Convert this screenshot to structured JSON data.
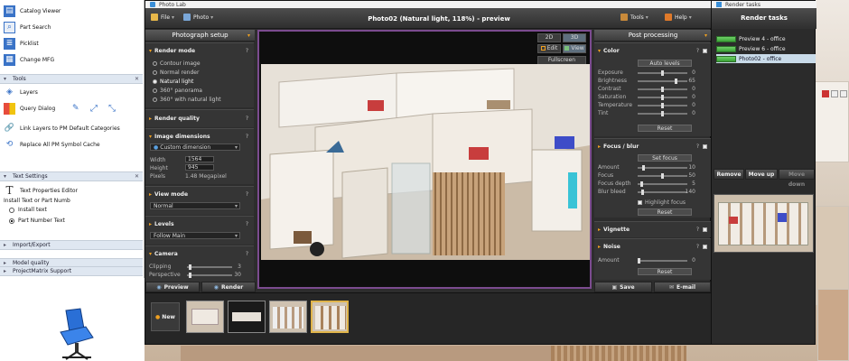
{
  "host_panel": {
    "items_top": [
      {
        "label": "Catalog Viewer",
        "icon": "catalog-icon",
        "color": "#3a73c7"
      },
      {
        "label": "Part Search",
        "icon": "part-search-icon",
        "color": "#3a73c7"
      },
      {
        "label": "Picklist",
        "icon": "picklist-icon",
        "color": "#3a73c7"
      },
      {
        "label": "Change MFG",
        "icon": "change-mfg-icon",
        "color": "#3a73c7"
      }
    ],
    "tools_header": "Tools",
    "tools_items": [
      {
        "label": "Layers",
        "icon": "layers-icon"
      },
      {
        "label": "Query Dialog",
        "icon": "query-icon"
      },
      {
        "label": "Link Layers to PM Default Categories",
        "icon": "link-icon"
      },
      {
        "label": "Replace All PM Symbol Cache",
        "icon": "replace-icon"
      }
    ],
    "text_settings_header": "Text Settings",
    "text_properties_label": "Text Properties Editor",
    "install_text_group": "Install Text or Part Numb",
    "install_text_option": "Install text",
    "part_number_option": "Part Number Text",
    "import_export_header": "Import/Export",
    "model_quality_header": "Model quality",
    "project_matrix_header": "ProjectMatrix Support"
  },
  "photo_lab": {
    "window_title": "Photo Lab",
    "menu_file": "File",
    "menu_photo": "Photo",
    "doc_title": "Photo02 (Natural light, 118%) - preview",
    "menu_tools": "Tools",
    "menu_help": "Help",
    "left_header": "Photograph setup",
    "right_header": "Post processing",
    "render_mode": {
      "title": "Render mode",
      "options": [
        "Contour image",
        "Normal render",
        "Natural light",
        "360° panorama",
        "360° with natural light"
      ],
      "selected": 2
    },
    "render_quality_title": "Render quality",
    "image_dimensions": {
      "title": "Image dimensions",
      "preset": "Custom dimension",
      "width_label": "Width",
      "width_value": "1564",
      "height_label": "Height",
      "height_value": "945",
      "pixels_label": "Pixels",
      "pixels_value": "1.48 Megapixel"
    },
    "view_mode": {
      "title": "View mode",
      "value": "Normal"
    },
    "levels": {
      "title": "Levels",
      "value": "Follow Main"
    },
    "camera": {
      "title": "Camera",
      "clipping_label": "Clipping",
      "clipping_value": "3",
      "perspective_label": "Perspective",
      "perspective_value": "30"
    },
    "view_buttons": {
      "b2d": "2D",
      "b3d": "3D",
      "edit": "Edit",
      "view": "View",
      "fullscreen": "Fullscreen"
    },
    "color": {
      "title": "Color",
      "auto_levels": "Auto levels",
      "sliders": [
        {
          "label": "Exposure",
          "value": 0,
          "frac": 0.5
        },
        {
          "label": "Brightness",
          "value": 65,
          "frac": 0.78
        },
        {
          "label": "Contrast",
          "value": 0,
          "frac": 0.5
        },
        {
          "label": "Saturation",
          "value": 0,
          "frac": 0.5
        },
        {
          "label": "Temperature",
          "value": 0,
          "frac": 0.5
        },
        {
          "label": "Tint",
          "value": 0,
          "frac": 0.5
        }
      ],
      "reset": "Reset"
    },
    "focus_blur": {
      "title": "Focus / blur",
      "set_focus": "Set focus",
      "sliders": [
        {
          "label": "Amount",
          "value": 10,
          "frac": 0.1
        },
        {
          "label": "Focus",
          "value": 50,
          "frac": 0.5
        },
        {
          "label": "Focus depth",
          "value": 5,
          "frac": 0.05
        },
        {
          "label": "Blur bleed",
          "value": 140,
          "frac": 0.08
        }
      ],
      "highlight_focus": "Highlight focus",
      "reset": "Reset"
    },
    "vignette_title": "Vignette",
    "noise": {
      "title": "Noise",
      "amount_label": "Amount",
      "amount_value": "0",
      "reset": "Reset"
    },
    "bottom": {
      "preview": "Preview",
      "render": "Render",
      "save": "Save",
      "email": "E-mail",
      "new": "New"
    }
  },
  "render_tasks": {
    "title": "Render tasks",
    "tasks": [
      {
        "name": "Preview 4 - office",
        "progress": 1.0
      },
      {
        "name": "Preview 6 - office",
        "progress": 1.0
      },
      {
        "name": "Photo02 - office",
        "progress": 1.0
      }
    ],
    "selected": 2,
    "remove": "Remove",
    "move_up": "Move up",
    "move_down": "Move down"
  },
  "colors": {
    "accent": "#f0a020",
    "frame": "#7b4b8f",
    "selection": "#c9dbe9"
  }
}
